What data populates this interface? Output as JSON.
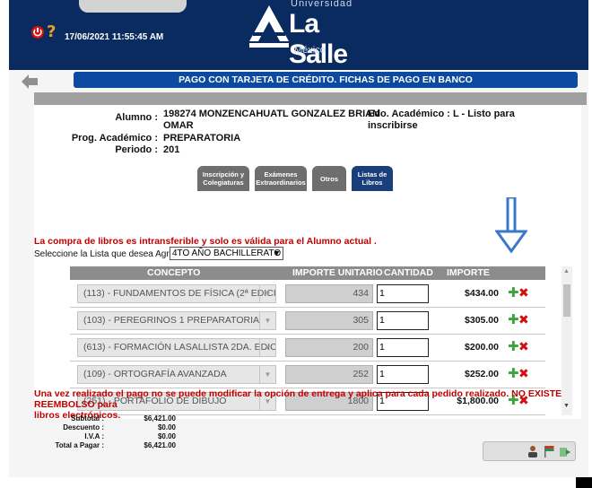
{
  "header": {
    "datetime": "17/06/2021 11:55:45 AM",
    "logo_top": "Universidad",
    "logo_main": "La Salle",
    "logo_sub": "México"
  },
  "title": "PAGO CON TARJETA DE CRÉDITO. FICHAS DE PAGO EN BANCO",
  "student": {
    "alumno_label": "Alumno :",
    "alumno_value_line1": "198274 MONZENCAHUATL GONZALEZ BRIAN",
    "alumno_value_line2": "OMAR",
    "edo_label_line1": "Edo. Académico : L - Listo para",
    "edo_label_line2": "inscribirse",
    "prog_label": "Prog. Académico :",
    "prog_value": "PREPARATORIA",
    "periodo_label": "Periodo :",
    "periodo_value": "201"
  },
  "tabs": [
    {
      "label": "Inscripción y Colegiaturas"
    },
    {
      "label": "Exámenes Extraordinarios"
    },
    {
      "label": "Otros"
    },
    {
      "label": "Listas de Libros"
    }
  ],
  "warning": "La compra de libros es intransferible y solo es válida para el Alumno actual .",
  "select": {
    "label": "Seleccione la Lista que desea Agregar:",
    "value": "4TO AÑO BACHILLERATO C"
  },
  "table": {
    "headers": {
      "concepto": "CONCEPTO",
      "importe_unitario": "IMPORTE UNITARIO",
      "cantidad": "CANTIDAD",
      "importe": "IMPORTE"
    },
    "rows": [
      {
        "concepto": "(113) - FUNDAMENTOS DE FÍSICA (2ª EDICI",
        "unit": "434",
        "qty": "1",
        "amount": "$434.00"
      },
      {
        "concepto": "(103) - PEREGRINOS 1 PREPARATORIA",
        "unit": "305",
        "qty": "1",
        "amount": "$305.00"
      },
      {
        "concepto": "(613) - FORMACIÓN LASALLISTA 2DA. EDICI",
        "unit": "200",
        "qty": "1",
        "amount": "$200.00"
      },
      {
        "concepto": "(109) - ORTOGRAFÍA AVANZADA",
        "unit": "252",
        "qty": "1",
        "amount": "$252.00"
      },
      {
        "concepto": "(251) - PORTAFOLIO DE DIBUJO",
        "unit": "1800",
        "qty": "1",
        "amount": "$1,800.00"
      }
    ]
  },
  "notice_line1": "Una vez realizado el pago no se puede modificar la opción de entrega y aplica para cada pedido realizado. NO EXISTE REEMBOLSO para",
  "notice_line2": "libros electrónicos.",
  "totals": {
    "subtotal_label": "Subtotal :",
    "subtotal": "$6,421.00",
    "descuento_label": "Descuento :",
    "descuento": "$0.00",
    "iva_label": "I.V.A :",
    "iva": "$0.00",
    "total_label": "Total a Pagar :",
    "total": "$6,421.00"
  },
  "colors": {
    "header": "#0a2b60",
    "title_bar": "#0b4aa0",
    "warning": "#c00000",
    "arrow": "#3a78c8"
  }
}
